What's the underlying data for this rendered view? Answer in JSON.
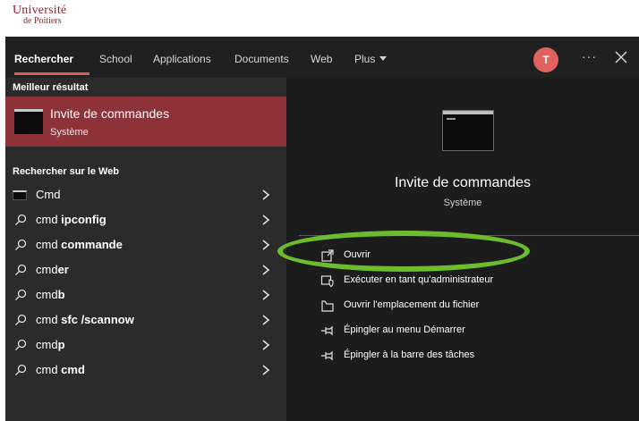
{
  "logo": {
    "line1": "Université",
    "line2": "de Poitiers"
  },
  "tabs": [
    {
      "label": "Rechercher",
      "active": true
    },
    {
      "label": "School"
    },
    {
      "label": "Applications"
    },
    {
      "label": "Documents"
    },
    {
      "label": "Web"
    },
    {
      "label": "Plus"
    }
  ],
  "user": {
    "initial": "T"
  },
  "more_label": "···",
  "colors": {
    "accent": "#e05a55",
    "best_bg": "#8c3238",
    "highlight": "#6cbd2e",
    "avatar": "#e0625e"
  },
  "left": {
    "best_header": "Meilleur résultat",
    "best": {
      "title": "Invite de commandes",
      "subtitle": "Système",
      "icon": "cmd-icon"
    },
    "web_header": "Rechercher sur le Web",
    "results": [
      {
        "prefix": "Cmd",
        "bold": "",
        "icon": "cmd-icon"
      },
      {
        "prefix": "cmd ",
        "bold": "ipconfig",
        "icon": "search-icon"
      },
      {
        "prefix": "cmd ",
        "bold": "commande",
        "icon": "search-icon"
      },
      {
        "prefix": "cmd",
        "bold": "er",
        "icon": "search-icon"
      },
      {
        "prefix": "cmd",
        "bold": "b",
        "icon": "search-icon"
      },
      {
        "prefix": "cmd ",
        "bold": "sfc /scannow",
        "icon": "search-icon"
      },
      {
        "prefix": "cmd",
        "bold": "p",
        "icon": "search-icon"
      },
      {
        "prefix": "cmd ",
        "bold": "cmd",
        "icon": "search-icon"
      }
    ]
  },
  "right": {
    "title": "Invite de commandes",
    "subtitle": "Système",
    "actions": [
      {
        "label": "Ouvrir",
        "icon": "open-icon"
      },
      {
        "label": "Exécuter en tant qu'administrateur",
        "icon": "shield-icon"
      },
      {
        "label": "Ouvrir l'emplacement du fichier",
        "icon": "folder-icon"
      },
      {
        "label": "Épingler au menu Démarrer",
        "icon": "pin-icon"
      },
      {
        "label": "Épingler à la barre des tâches",
        "icon": "pin-icon"
      }
    ]
  }
}
